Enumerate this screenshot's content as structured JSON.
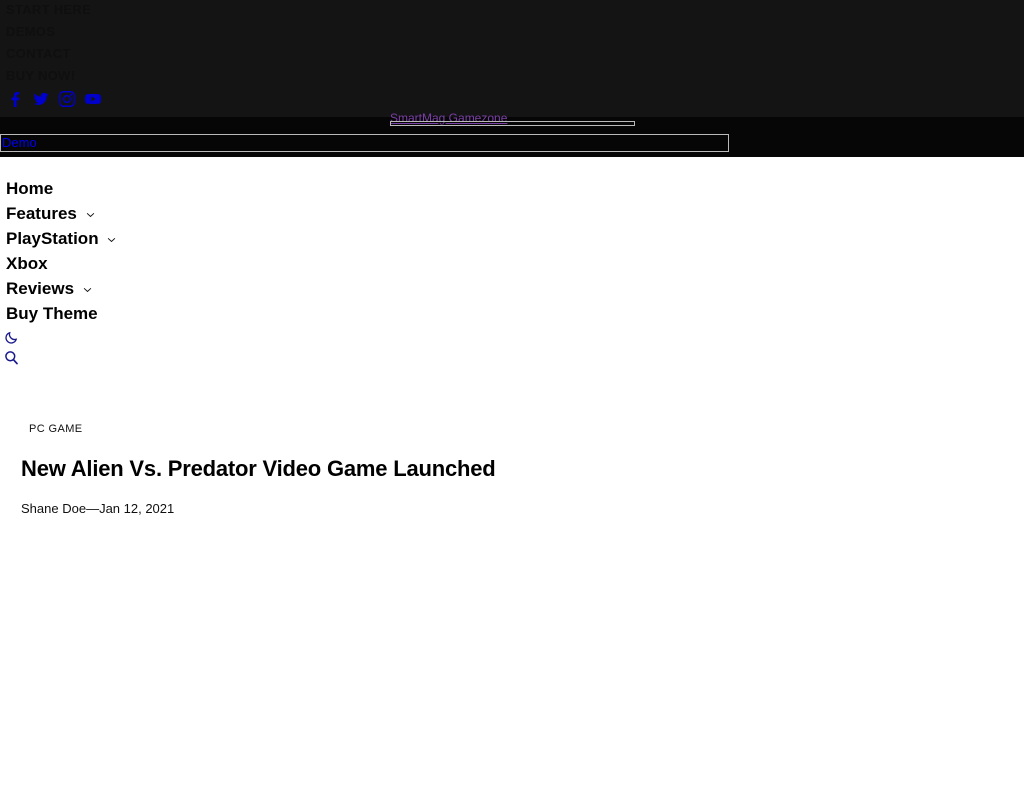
{
  "topbar": {
    "menu": [
      {
        "label": "START HERE",
        "name": "topbar-item-start-here"
      },
      {
        "label": "DEMOS",
        "name": "topbar-item-demos"
      },
      {
        "label": "CONTACT",
        "name": "topbar-item-contact"
      },
      {
        "label": "BUY NOW!",
        "name": "topbar-item-buy-now"
      }
    ],
    "social": [
      {
        "icon": "facebook-icon",
        "label": "Facebook"
      },
      {
        "icon": "twitter-icon",
        "label": "Twitter"
      },
      {
        "icon": "instagram-icon",
        "label": "Instagram"
      },
      {
        "icon": "youtube-icon",
        "label": "YouTube"
      }
    ],
    "colors": {
      "background": "#141414",
      "text": "#0f0f0f",
      "social_icon": "#0000cc"
    }
  },
  "header": {
    "site_logo_text": "SmartMag Gamezone",
    "demo_link_text": "Demo",
    "colors": {
      "background": "#060606",
      "logo_link": "#7b3fa8",
      "demo_link": "#0000ee",
      "box_border": "#b9b9b9"
    }
  },
  "nav": {
    "items": [
      {
        "label": "Home",
        "has_dropdown": false,
        "name": "nav-item-home"
      },
      {
        "label": "Features",
        "has_dropdown": true,
        "name": "nav-item-features"
      },
      {
        "label": "PlayStation",
        "has_dropdown": true,
        "name": "nav-item-playstation"
      },
      {
        "label": "Xbox",
        "has_dropdown": false,
        "name": "nav-item-xbox"
      },
      {
        "label": "Reviews",
        "has_dropdown": true,
        "name": "nav-item-reviews"
      },
      {
        "label": "Buy Theme",
        "has_dropdown": false,
        "name": "nav-item-buy-theme"
      }
    ],
    "dark_mode_icon": "moon-icon",
    "search_icon": "search-icon",
    "icon_color": "#1a1a8c"
  },
  "article": {
    "category": "PC GAME",
    "title": "New Alien Vs. Predator Video Game Launched",
    "author": "Shane Doe",
    "separator": "—",
    "date": "Jan 12, 2021"
  }
}
